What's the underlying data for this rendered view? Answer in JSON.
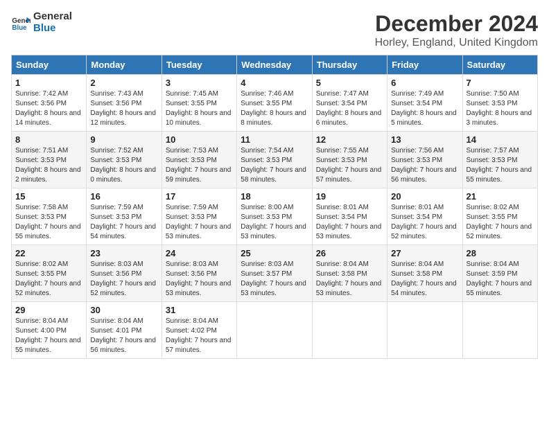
{
  "logo": {
    "line1": "General",
    "line2": "Blue"
  },
  "title": "December 2024",
  "subtitle": "Horley, England, United Kingdom",
  "days_header": [
    "Sunday",
    "Monday",
    "Tuesday",
    "Wednesday",
    "Thursday",
    "Friday",
    "Saturday"
  ],
  "weeks": [
    [
      {
        "day": "1",
        "sunrise": "7:42 AM",
        "sunset": "3:56 PM",
        "daylight": "8 hours and 14 minutes."
      },
      {
        "day": "2",
        "sunrise": "7:43 AM",
        "sunset": "3:56 PM",
        "daylight": "8 hours and 12 minutes."
      },
      {
        "day": "3",
        "sunrise": "7:45 AM",
        "sunset": "3:55 PM",
        "daylight": "8 hours and 10 minutes."
      },
      {
        "day": "4",
        "sunrise": "7:46 AM",
        "sunset": "3:55 PM",
        "daylight": "8 hours and 8 minutes."
      },
      {
        "day": "5",
        "sunrise": "7:47 AM",
        "sunset": "3:54 PM",
        "daylight": "8 hours and 6 minutes."
      },
      {
        "day": "6",
        "sunrise": "7:49 AM",
        "sunset": "3:54 PM",
        "daylight": "8 hours and 5 minutes."
      },
      {
        "day": "7",
        "sunrise": "7:50 AM",
        "sunset": "3:53 PM",
        "daylight": "8 hours and 3 minutes."
      }
    ],
    [
      {
        "day": "8",
        "sunrise": "7:51 AM",
        "sunset": "3:53 PM",
        "daylight": "8 hours and 2 minutes."
      },
      {
        "day": "9",
        "sunrise": "7:52 AM",
        "sunset": "3:53 PM",
        "daylight": "8 hours and 0 minutes."
      },
      {
        "day": "10",
        "sunrise": "7:53 AM",
        "sunset": "3:53 PM",
        "daylight": "7 hours and 59 minutes."
      },
      {
        "day": "11",
        "sunrise": "7:54 AM",
        "sunset": "3:53 PM",
        "daylight": "7 hours and 58 minutes."
      },
      {
        "day": "12",
        "sunrise": "7:55 AM",
        "sunset": "3:53 PM",
        "daylight": "7 hours and 57 minutes."
      },
      {
        "day": "13",
        "sunrise": "7:56 AM",
        "sunset": "3:53 PM",
        "daylight": "7 hours and 56 minutes."
      },
      {
        "day": "14",
        "sunrise": "7:57 AM",
        "sunset": "3:53 PM",
        "daylight": "7 hours and 55 minutes."
      }
    ],
    [
      {
        "day": "15",
        "sunrise": "7:58 AM",
        "sunset": "3:53 PM",
        "daylight": "7 hours and 55 minutes."
      },
      {
        "day": "16",
        "sunrise": "7:59 AM",
        "sunset": "3:53 PM",
        "daylight": "7 hours and 54 minutes."
      },
      {
        "day": "17",
        "sunrise": "7:59 AM",
        "sunset": "3:53 PM",
        "daylight": "7 hours and 53 minutes."
      },
      {
        "day": "18",
        "sunrise": "8:00 AM",
        "sunset": "3:53 PM",
        "daylight": "7 hours and 53 minutes."
      },
      {
        "day": "19",
        "sunrise": "8:01 AM",
        "sunset": "3:54 PM",
        "daylight": "7 hours and 53 minutes."
      },
      {
        "day": "20",
        "sunrise": "8:01 AM",
        "sunset": "3:54 PM",
        "daylight": "7 hours and 52 minutes."
      },
      {
        "day": "21",
        "sunrise": "8:02 AM",
        "sunset": "3:55 PM",
        "daylight": "7 hours and 52 minutes."
      }
    ],
    [
      {
        "day": "22",
        "sunrise": "8:02 AM",
        "sunset": "3:55 PM",
        "daylight": "7 hours and 52 minutes."
      },
      {
        "day": "23",
        "sunrise": "8:03 AM",
        "sunset": "3:56 PM",
        "daylight": "7 hours and 52 minutes."
      },
      {
        "day": "24",
        "sunrise": "8:03 AM",
        "sunset": "3:56 PM",
        "daylight": "7 hours and 53 minutes."
      },
      {
        "day": "25",
        "sunrise": "8:03 AM",
        "sunset": "3:57 PM",
        "daylight": "7 hours and 53 minutes."
      },
      {
        "day": "26",
        "sunrise": "8:04 AM",
        "sunset": "3:58 PM",
        "daylight": "7 hours and 53 minutes."
      },
      {
        "day": "27",
        "sunrise": "8:04 AM",
        "sunset": "3:58 PM",
        "daylight": "7 hours and 54 minutes."
      },
      {
        "day": "28",
        "sunrise": "8:04 AM",
        "sunset": "3:59 PM",
        "daylight": "7 hours and 55 minutes."
      }
    ],
    [
      {
        "day": "29",
        "sunrise": "8:04 AM",
        "sunset": "4:00 PM",
        "daylight": "7 hours and 55 minutes."
      },
      {
        "day": "30",
        "sunrise": "8:04 AM",
        "sunset": "4:01 PM",
        "daylight": "7 hours and 56 minutes."
      },
      {
        "day": "31",
        "sunrise": "8:04 AM",
        "sunset": "4:02 PM",
        "daylight": "7 hours and 57 minutes."
      },
      null,
      null,
      null,
      null
    ]
  ]
}
